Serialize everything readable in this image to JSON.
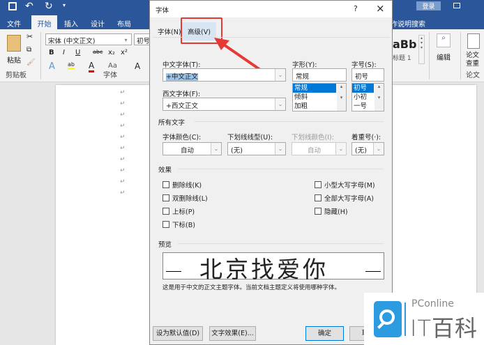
{
  "word": {
    "tabs": [
      "文件",
      "开始",
      "插入",
      "设计",
      "布局"
    ],
    "search_tab": "作说明搜索",
    "login": "登录",
    "clipboard": {
      "paste": "粘贴",
      "group": "剪贴板"
    },
    "font": {
      "name": "宋体 (中文正文)",
      "size": "初号",
      "group": "字体"
    },
    "styles": {
      "preview": "aBb",
      "name": "标题 1"
    },
    "editing": "编辑",
    "paper_check": "论文查重",
    "paper_group": "论文"
  },
  "dialog": {
    "title": "字体",
    "help": "?",
    "close": "×",
    "tabs": [
      "字体(N)",
      "高级(V)"
    ],
    "cn_font_label": "中文字体(T):",
    "cn_font": "+中文正文",
    "west_font_label": "西文字体(F):",
    "west_font": "+西文正文",
    "style_label": "字形(Y):",
    "style": "常规",
    "style_options": [
      "常规",
      "倾斜",
      "加粗"
    ],
    "size_label": "字号(S):",
    "size": "初号",
    "size_options": [
      "初号",
      "小初",
      "一号"
    ],
    "all_text": "所有文字",
    "color_label": "字体颜色(C):",
    "color": "自动",
    "underline_label": "下划线线型(U):",
    "underline": "(无)",
    "ucolor_label": "下划线颜色(I):",
    "ucolor": "自动",
    "emph_label": "着重号(·):",
    "emph": "(无)",
    "effects": "效果",
    "effects_left": [
      "删除线(K)",
      "双删除线(L)",
      "上标(P)",
      "下标(B)"
    ],
    "effects_right": [
      "小型大写字母(M)",
      "全部大写字母(A)",
      "隐藏(H)"
    ],
    "preview_label": "预览",
    "preview_text": "北京找爱你",
    "preview_desc": "这是用于中文的正文主题字体。当前文档主题定义将使用哪种字体。",
    "set_default": "设为默认值(D)",
    "text_effects": "文字效果(E)...",
    "ok": "确定",
    "cancel": "取消"
  },
  "watermark": {
    "brand": "PConline",
    "name": "IT百科"
  },
  "colors": {
    "accent": "#2b579a",
    "highlight": "#e53935",
    "select": "#0078d7"
  }
}
